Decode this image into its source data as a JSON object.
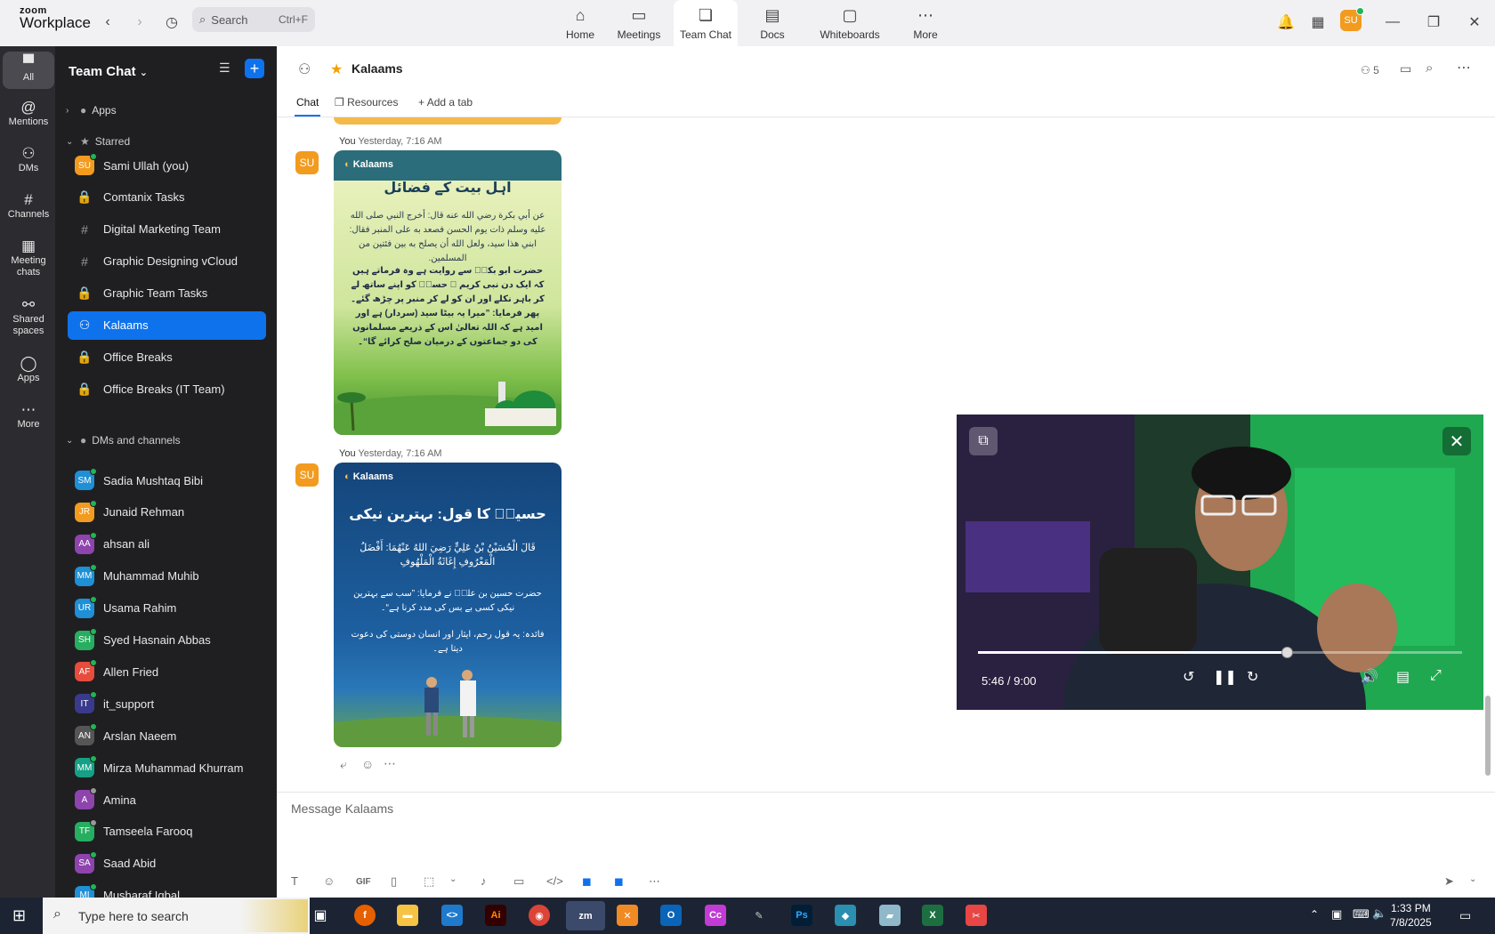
{
  "app": {
    "logo_line1": "zoom",
    "logo_line2": "Workplace"
  },
  "search": {
    "label": "Search",
    "shortcut": "Ctrl+F"
  },
  "nav": [
    {
      "label": "Home",
      "icon": "home-icon"
    },
    {
      "label": "Meetings",
      "icon": "video-icon"
    },
    {
      "label": "Team Chat",
      "icon": "chat-icon"
    },
    {
      "label": "Docs",
      "icon": "doc-icon"
    },
    {
      "label": "Whiteboards",
      "icon": "whiteboard-icon"
    },
    {
      "label": "More",
      "icon": "more-icon"
    }
  ],
  "user_initials": "SU",
  "rail": [
    {
      "label": "All"
    },
    {
      "label": "Mentions"
    },
    {
      "label": "DMs"
    },
    {
      "label": "Channels"
    },
    {
      "label": "Meeting chats"
    },
    {
      "label": "Shared spaces"
    },
    {
      "label": "Apps"
    },
    {
      "label": "More"
    }
  ],
  "sidebar": {
    "title": "Team Chat",
    "apps_label": "Apps",
    "starred_label": "Starred",
    "dms_label": "DMs and channels",
    "starred": [
      {
        "label": "Sami Ullah (you)",
        "initials": "SU",
        "color": "#f29b1f",
        "status": "#20b556"
      },
      {
        "label": "Comtanix Tasks",
        "kind": "lock"
      },
      {
        "label": "Digital Marketing Team",
        "kind": "hash"
      },
      {
        "label": "Graphic Designing vCloud",
        "kind": "hash"
      },
      {
        "label": "Graphic Team Tasks",
        "kind": "lock"
      },
      {
        "label": "Kalaams",
        "kind": "people",
        "active": true
      },
      {
        "label": "Office Breaks",
        "kind": "lock"
      },
      {
        "label": "Office Breaks (IT Team)",
        "kind": "lock"
      }
    ],
    "dms": [
      {
        "label": "Sadia Mushtaq Bibi",
        "initials": "SM",
        "color": "#1f8fd6",
        "status": "#20b556"
      },
      {
        "label": "Junaid Rehman",
        "initials": "JR",
        "color": "#f29b1f",
        "status": "#20b556"
      },
      {
        "label": "ahsan ali",
        "initials": "AA",
        "color": "#8e44ad",
        "status": "#20b556"
      },
      {
        "label": "Muhammad Muhib",
        "initials": "MM",
        "color": "#1f8fd6",
        "status": "#20b556"
      },
      {
        "label": "Usama Rahim",
        "initials": "UR",
        "color": "#1f8fd6",
        "status": "#20b556"
      },
      {
        "label": "Syed Hasnain Abbas",
        "initials": "SH",
        "color": "#27ae60",
        "status": "#20b556"
      },
      {
        "label": "Allen Fried",
        "initials": "AF",
        "color": "#e74c3c",
        "status": "#20b556"
      },
      {
        "label": "it_support",
        "initials": "IT",
        "color": "#3a3a8c",
        "status": "#20b556"
      },
      {
        "label": "Arslan Naeem",
        "initials": "AN",
        "color": "#555555",
        "status": "#20b556"
      },
      {
        "label": "Mirza Muhammad Khurram",
        "initials": "MM",
        "color": "#16a085",
        "status": "#20b556"
      },
      {
        "label": "Amina",
        "initials": "A",
        "color": "#8e44ad",
        "status": "#999999"
      },
      {
        "label": "Tamseela Farooq",
        "initials": "TF",
        "color": "#27ae60",
        "status": "#999999"
      },
      {
        "label": "Saad Abid",
        "initials": "SA",
        "color": "#8e44ad",
        "status": "#20b556"
      },
      {
        "label": "Musharaf Iqbal",
        "initials": "MI",
        "color": "#1f8fd6",
        "status": "#20b556"
      }
    ]
  },
  "channel": {
    "name": "Kalaams",
    "member_count": "5",
    "tabs": [
      "Chat",
      "Resources",
      "Add a tab"
    ],
    "messages": [
      {
        "author": "You",
        "time": "Yesterday, 7:16 AM"
      },
      {
        "author": "You",
        "time": "Yesterday, 7:16 AM"
      }
    ],
    "card1": {
      "brand": "Kalaams",
      "title": "اہل بیت کے فضائل",
      "arabic": "عن أبي بكرة رضي الله عنه قال: أخرج النبي صلى الله عليه وسلم ذات يوم الحسن فصعد به على المنبر فقال: ابني هذا سيد، ولعل الله أن يصلح به بين فئتين من المسلمين.",
      "urdu": "حضرت ابو بکرؓ سے روایت ہے وہ فرماتے ہیں کہ ایک دن نبی کریم ﷺ حسنؓ کو اپنے ساتھ لے کر باہر نکلے اور ان کو لے کر منبر پر چڑھ گئے۔ پھر فرمایا: ”میرا یہ بیٹا سید (سردار) ہے اور امید ہے کہ اللہ تعالیٰ اس کے ذریعے مسلمانوں کی دو جماعتوں کے درمیان صلح کرائے گا“۔"
    },
    "card2": {
      "brand": "Kalaams",
      "title": "حسینؓ کا قول: بہترین نیکی",
      "arabic": "قَالَ الْحُسَيْنُ بْنُ عَلِيٍّ رَضِيَ اللهُ عَنْهُمَا: أَفْضَلُ الْمَعْرُوفِ إِغَاثَةُ الْمَلْهُوفِ",
      "urdu": "حضرت حسین بن علیؓ نے فرمایا: ”سب سے بہترین نیکی کسی بے بس کی مدد کرنا ہے“۔",
      "note": "فائدہ: یہ قول رحم، ایثار اور انسان دوستی کی دعوت دیتا ہے۔"
    },
    "composer_placeholder": "Message Kalaams"
  },
  "video": {
    "time": "5:46 / 9:00",
    "progress": 0.64
  },
  "taskbar": {
    "search_placeholder": "Type here to search",
    "time": "1:33 PM",
    "date": "7/8/2025"
  }
}
